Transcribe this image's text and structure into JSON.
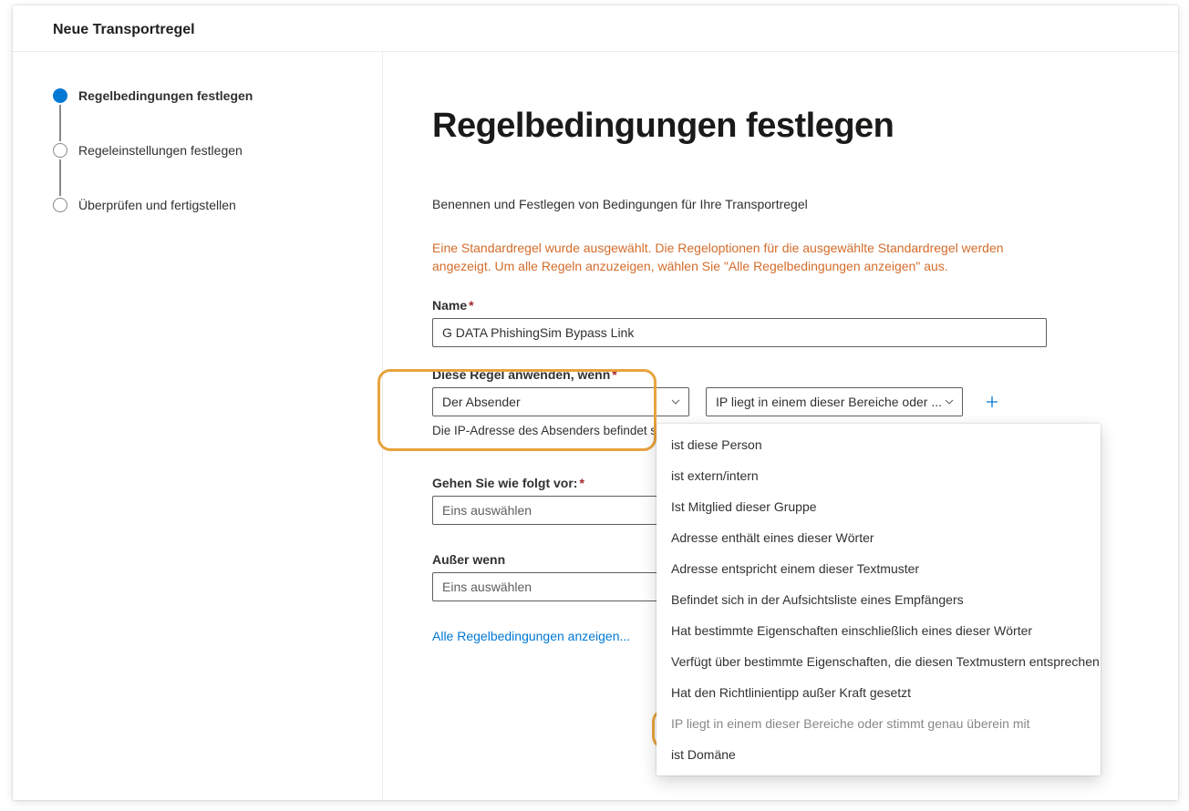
{
  "panel": {
    "title": "Neue Transportregel"
  },
  "steps": [
    {
      "label": "Regelbedingungen festlegen",
      "active": true
    },
    {
      "label": "Regeleinstellungen festlegen",
      "active": false
    },
    {
      "label": "Überprüfen und fertigstellen",
      "active": false
    }
  ],
  "main": {
    "heading": "Regelbedingungen festlegen",
    "description": "Benennen und Festlegen von Bedingungen für Ihre Transportregel",
    "warning": "Eine Standardregel wurde ausgewählt. Die Regeloptionen für die ausgewählte Standardregel werden angezeigt. Um alle Regeln anzuzeigen, wählen Sie \"Alle Regelbedingungen anzeigen\" aus.",
    "name_label": "Name",
    "name_value": "G DATA PhishingSim Bypass Link",
    "apply_when_label": "Diese Regel anwenden, wenn",
    "apply_when_select": "Der Absender",
    "apply_when_select2": "IP liegt in einem dieser Bereiche oder ...",
    "apply_when_hint": "Die IP-Adresse des Absenders befindet sich im Bereich...",
    "do_label": "Gehen Sie wie folgt vor:",
    "do_select": "Eins auswählen",
    "except_label": "Außer wenn",
    "except_select": "Eins auswählen",
    "show_all_link": "Alle Regelbedingungen anzeigen..."
  },
  "dropdown": {
    "items": [
      "ist diese Person",
      "ist extern/intern",
      "Ist Mitglied dieser Gruppe",
      "Adresse enthält eines dieser Wörter",
      "Adresse entspricht einem dieser Textmuster",
      "Befindet sich in der Aufsichtsliste eines Empfängers",
      "Hat bestimmte Eigenschaften einschließlich eines dieser Wörter",
      "Verfügt über bestimmte Eigenschaften, die diesen Textmustern entsprechen",
      "Hat den Richtlinientipp außer Kraft gesetzt",
      "IP liegt in einem dieser Bereiche oder stimmt genau überein mit",
      "ist Domäne"
    ],
    "selected_index": 9
  }
}
